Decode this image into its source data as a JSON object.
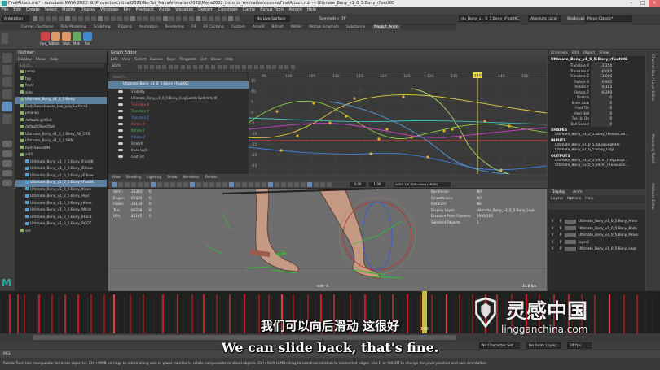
{
  "window": {
    "title": "FinalAttack.mb* - Autodesk MAYA 2022: G:\\ProyectosCriticall2021\\NerTut_MayaAnimation2022\\Maya2022_Intro_to_Animation\\scenes\\FinalAttack.mb  ---  Ultimate_Bony_v1_0_5:Bony_rFootIKC"
  },
  "menubar": [
    "File",
    "Edit",
    "Create",
    "Select",
    "Modify",
    "Display",
    "Windows",
    "Key",
    "Playback",
    "Audio",
    "Visualize",
    "Deform",
    "Constrain",
    "Cache",
    "Bonus Tools",
    "Arnold",
    "Help"
  ],
  "statusline": {
    "mode": "Animation",
    "no_live": "No Live Surface",
    "symmetry": "Symmetry: Off",
    "object": "du_Bony_v1_0_5:Bony_rFootIKC",
    "workspace_label": "Workspace :",
    "workspace": "Maya Classic*",
    "absolute": "Absolute Local"
  },
  "shelf_tabs": [
    "Curves / Surfaces",
    "Poly Modeling",
    "Sculpting",
    "Rigging",
    "Animation",
    "Rendering",
    "FX",
    "FX Caching",
    "Custom",
    "Arnold",
    "Bifrost",
    "MASH",
    "Motion Graphics",
    "Substance",
    "Naskut_Anim"
  ],
  "shelf_active": "Naskut_Anim",
  "shelf_buttons": [
    "Fwe_Tut",
    "Walk",
    "Walk",
    "Milk",
    "Rel"
  ],
  "outliner": {
    "title": "Outliner",
    "menu": [
      "Display",
      "Show",
      "Help"
    ],
    "search": "Search...",
    "rows": [
      {
        "label": "persp",
        "hl": false,
        "indent": 1
      },
      {
        "label": "top",
        "hl": false,
        "indent": 1
      },
      {
        "label": "front",
        "hl": false,
        "indent": 1
      },
      {
        "label": "side",
        "hl": false,
        "indent": 1
      },
      {
        "label": "Ultimate_Bony_v1_0_5:Bony",
        "hl": true,
        "indent": 1
      },
      {
        "label": "RudySwordsword_low_polySurface1",
        "hl": false,
        "indent": 1
      },
      {
        "label": "pPlane1",
        "hl": false,
        "indent": 1
      },
      {
        "label": "defaultLightSet",
        "hl": false,
        "indent": 1
      },
      {
        "label": "defaultObjectSet",
        "hl": false,
        "indent": 1
      },
      {
        "label": "Ultimate_Bony_v1_0_5:Bony_All_CRTs",
        "hl": false,
        "indent": 1
      },
      {
        "label": "Ultimate_Bony_v1_0_5:SKN",
        "hl": false,
        "indent": 1
      },
      {
        "label": "RudySwordRN",
        "hl": false,
        "indent": 1
      },
      {
        "label": "set1",
        "hl": false,
        "indent": 1
      },
      {
        "label": "Ultimate_Bony_v1_0_5:Bony_lFootIK",
        "hl": false,
        "indent": 2
      },
      {
        "label": "Ultimate_Bony_v1_0_5:Bony_lElbow",
        "hl": false,
        "indent": 2
      },
      {
        "label": "Ultimate_Bony_v1_0_5:Bony_rElbow",
        "hl": false,
        "indent": 2
      },
      {
        "label": "Ultimate_Bony_v1_0_5:Bony_rFootIK",
        "hl": true,
        "indent": 2
      },
      {
        "label": "Ultimate_Bony_v1_0_5:Bony_lKnee",
        "hl": false,
        "indent": 2
      },
      {
        "label": "Ultimate_Bony_v1_0_5:Bony_Hips",
        "hl": false,
        "indent": 2
      },
      {
        "label": "Ultimate_Bony_v1_0_5:Bony_rKnee",
        "hl": false,
        "indent": 2
      },
      {
        "label": "Ultimate_Bony_v1_0_5:Bony_lWrist",
        "hl": false,
        "indent": 2
      },
      {
        "label": "Ultimate_Bony_v1_0_5:Bony_lHand",
        "hl": false,
        "indent": 2
      },
      {
        "label": "Ultimate_Bony_v1_0_5:Bony_ROOT",
        "hl": false,
        "indent": 2
      },
      {
        "label": "set",
        "hl": false,
        "indent": 1
      }
    ]
  },
  "graph_editor": {
    "title": "Graph Editor",
    "menu": [
      "Edit",
      "View",
      "Select",
      "Curves",
      "Keys",
      "Tangents",
      "List",
      "Show",
      "Help"
    ],
    "stats_label": "Stats",
    "node": "Ultimate_Bony_v1_0_5:Bony_rFootIKC",
    "channels": [
      "Visibility",
      "Ultimate_Bony_v1_0_5:Bony_rLegSwitch Switch to IK",
      "Translate X",
      "Translate Y",
      "Translate Z",
      "Rotate X",
      "Rotate Y",
      "Rotate Z",
      "Stretch",
      "Knee Lock",
      "Foot Tilt"
    ],
    "channel_colors": [
      "#cccccc",
      "#cccccc",
      "#e05050",
      "#50c050",
      "#5080e0",
      "#e05050",
      "#50c050",
      "#5080e0",
      "#cccccc",
      "#cccccc",
      "#cccccc"
    ],
    "y_ticks": [
      "15",
      "10",
      "5",
      "0",
      "-5",
      "-10",
      "-15",
      "-20",
      "-25"
    ],
    "x_ticks": [
      "95",
      "100",
      "105",
      "110",
      "115",
      "120",
      "125",
      "130",
      "135",
      "140",
      "145",
      "150"
    ],
    "current_frame": "140"
  },
  "viewport": {
    "menu": [
      "View",
      "Shading",
      "Lighting",
      "Show",
      "Renderer",
      "Panels"
    ],
    "hud_left": [
      [
        "Verts:",
        "33303",
        "0"
      ],
      [
        "Edges:",
        "66420",
        "0"
      ],
      [
        "Faces:",
        "33134",
        "0"
      ],
      [
        "Tris:",
        "66238",
        "0"
      ],
      [
        "UVs:",
        "42165",
        "0"
      ]
    ],
    "hud_right": [
      [
        "Backfaces:",
        "N/A"
      ],
      [
        "Smoothness:",
        "N/A"
      ],
      [
        "Instance:",
        "No"
      ],
      [
        "Display Layer:",
        "Ultimate_Bony_v1_0_5:Bony_Legs"
      ],
      [
        "Distance From Camera:",
        "1093.125"
      ],
      [
        "Selected Objects:",
        "1"
      ]
    ],
    "colorspace": "ACES 1.0 SDR-video (sRGB)",
    "fps": "14.8 fps",
    "camera": "side -X",
    "gamma": "1.00",
    "exposure": "0.00"
  },
  "channel_box": {
    "menu": [
      "Channels",
      "Edit",
      "Object",
      "Show"
    ],
    "node": "Ultimate_Bony_v1_0_5:Bony_rFootIKC",
    "attrs": [
      [
        "Translate X",
        "2.254"
      ],
      [
        "Translate Y",
        "-0.004"
      ],
      [
        "Translate Z",
        "11.066"
      ],
      [
        "Rotate X",
        "-0.945"
      ],
      [
        "Rotate Y",
        "6.163"
      ],
      [
        "Rotate Z",
        "-6.280"
      ],
      [
        "Stretch",
        "0"
      ],
      [
        "Knee Lock",
        "0"
      ],
      [
        "Foot Tilt",
        "0"
      ],
      [
        "Heel Ball",
        "0"
      ],
      [
        "Toe Up Dn",
        "0"
      ],
      [
        "Ball Swivel",
        "0"
      ]
    ],
    "shapes_label": "SHAPES",
    "shapes": [
      "Ultimate_Bony_v1_0_5:Bony_rFootIKCSh..."
    ],
    "inputs_label": "INPUTS",
    "inputs": [
      "Ultimate_Bony_v1_0_5:lbLowLegIKHs",
      "Ultimate_Bony_v1_0_5:Bony_Legs"
    ],
    "outputs_label": "OUTPUTS",
    "outputs": [
      "Ultimate_Bony_v1_0_5:Jetcln_rLegLongt...",
      "Ultimate_Bony_v1_0_5:Jetcln_rKneeLock..."
    ]
  },
  "layer_editor": {
    "tabs": [
      "Display",
      "Anim"
    ],
    "menu": [
      "Layers",
      "Options",
      "Help"
    ],
    "layers": [
      "Ultimate_Bony_v1_0_5:Bony_Arms",
      "Ultimate_Bony_v1_0_5:Bony_Body",
      "Ultimate_Bony_v1_0_5:Bony_Pelvis",
      "layer1",
      "Ultimate_Bony_v1_0_5:Bony_Legs"
    ]
  },
  "vertical_tabs": [
    "Channel Box / Layer Editor",
    "Modelling Toolkit",
    "Attribute Editor"
  ],
  "time_range": {
    "current": "140",
    "no_char": "No Character Set",
    "no_anim": "No Anim Layer",
    "fps": "24 fps"
  },
  "command_line": {
    "lang": "MEL"
  },
  "help_line": "Rotate Tool: Use manipulator to rotate object(s). Ctrl+MMB on rings to rotate along axis or plane handles to rotate components or stand objects. Ctrl+Shift+LMB+drag to constrain rotation to connected edges. Use D or INSERT to change the pivot position and axis orientation.",
  "subtitles": {
    "zh": "我们可以向后滑动 这很好",
    "en": "We can slide back, that's fine."
  },
  "watermark": {
    "cn": "灵感中国",
    "url": "lingganchina.com"
  }
}
